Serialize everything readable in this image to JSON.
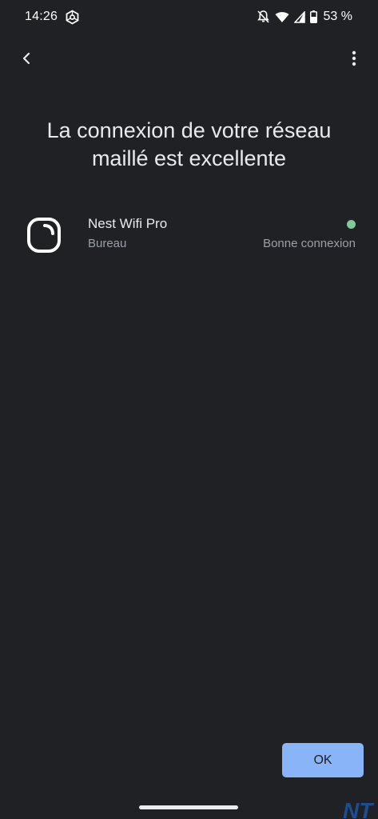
{
  "status_bar": {
    "time": "14:26",
    "battery_percent": "53 %",
    "icons": [
      "app-hexagon-icon",
      "notifications-off-icon",
      "wifi-icon",
      "signal-icon",
      "battery-icon"
    ]
  },
  "app_bar": {
    "back_icon": "chevron-left-icon",
    "more_icon": "more-vert-icon"
  },
  "title": "La connexion de votre réseau maillé est excellente",
  "devices": [
    {
      "name": "Nest Wifi Pro",
      "room": "Bureau",
      "status": "Bonne connexion",
      "status_color": "#81c995",
      "icon": "nest-wifi-pro-icon"
    }
  ],
  "ok_button": {
    "label": "OK",
    "color": "#8ab4f8"
  },
  "colors": {
    "background": "#202124",
    "text_primary": "#e8eaed",
    "text_secondary": "#9aa0a6"
  },
  "watermark": {
    "text": "NT"
  }
}
